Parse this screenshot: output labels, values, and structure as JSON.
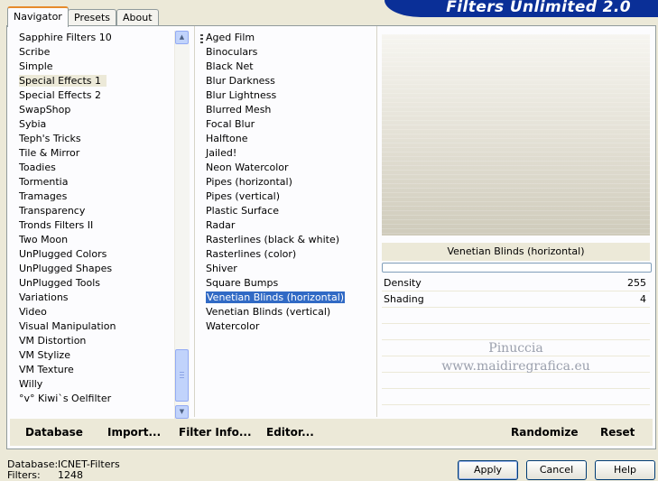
{
  "banner_title": "Filters Unlimited 2.0",
  "tabs": [
    "Navigator",
    "Presets",
    "About"
  ],
  "categories": [
    "Sapphire Filters 10",
    "Scribe",
    "Simple",
    "Special Effects 1",
    "Special Effects 2",
    "SwapShop",
    "Sybia",
    "Teph's Tricks",
    "Tile & Mirror",
    "Toadies",
    "Tormentia",
    "Tramages",
    "Transparency",
    "Tronds Filters II",
    "Two Moon",
    "UnPlugged Colors",
    "UnPlugged Shapes",
    "UnPlugged Tools",
    "Variations",
    "Video",
    "Visual Manipulation",
    "VM Distortion",
    "VM Stylize",
    "VM Texture",
    "Willy",
    "°v° Kiwi`s Oelfilter"
  ],
  "selected_category": "Special Effects 1",
  "filters": [
    "Aged Film",
    "Binoculars",
    "Black Net",
    "Blur Darkness",
    "Blur Lightness",
    "Blurred Mesh",
    "Focal Blur",
    "Halftone",
    "Jailed!",
    "Neon Watercolor",
    "Pipes (horizontal)",
    "Pipes (vertical)",
    "Plastic Surface",
    "Radar",
    "Rasterlines (black & white)",
    "Rasterlines (color)",
    "Shiver",
    "Square Bumps",
    "Venetian Blinds (horizontal)",
    "Venetian Blinds (vertical)",
    "Watercolor"
  ],
  "selected_filter": "Venetian Blinds (horizontal)",
  "filter_name": "Venetian Blinds (horizontal)",
  "params": [
    {
      "label": "Density",
      "value": "255"
    },
    {
      "label": "Shading",
      "value": "4"
    }
  ],
  "watermark": [
    "Pinuccia",
    "www.maidiregrafica.eu"
  ],
  "bottom_bar": {
    "database": "Database",
    "import": "Import...",
    "filter_info": "Filter Info...",
    "editor": "Editor...",
    "randomize": "Randomize",
    "reset": "Reset"
  },
  "info": {
    "database_label": "Database:",
    "database_value": "ICNET-Filters",
    "filters_label": "Filters:",
    "filters_value": "1248"
  },
  "buttons": {
    "apply": "Apply",
    "cancel": "Cancel",
    "help": "Help"
  }
}
